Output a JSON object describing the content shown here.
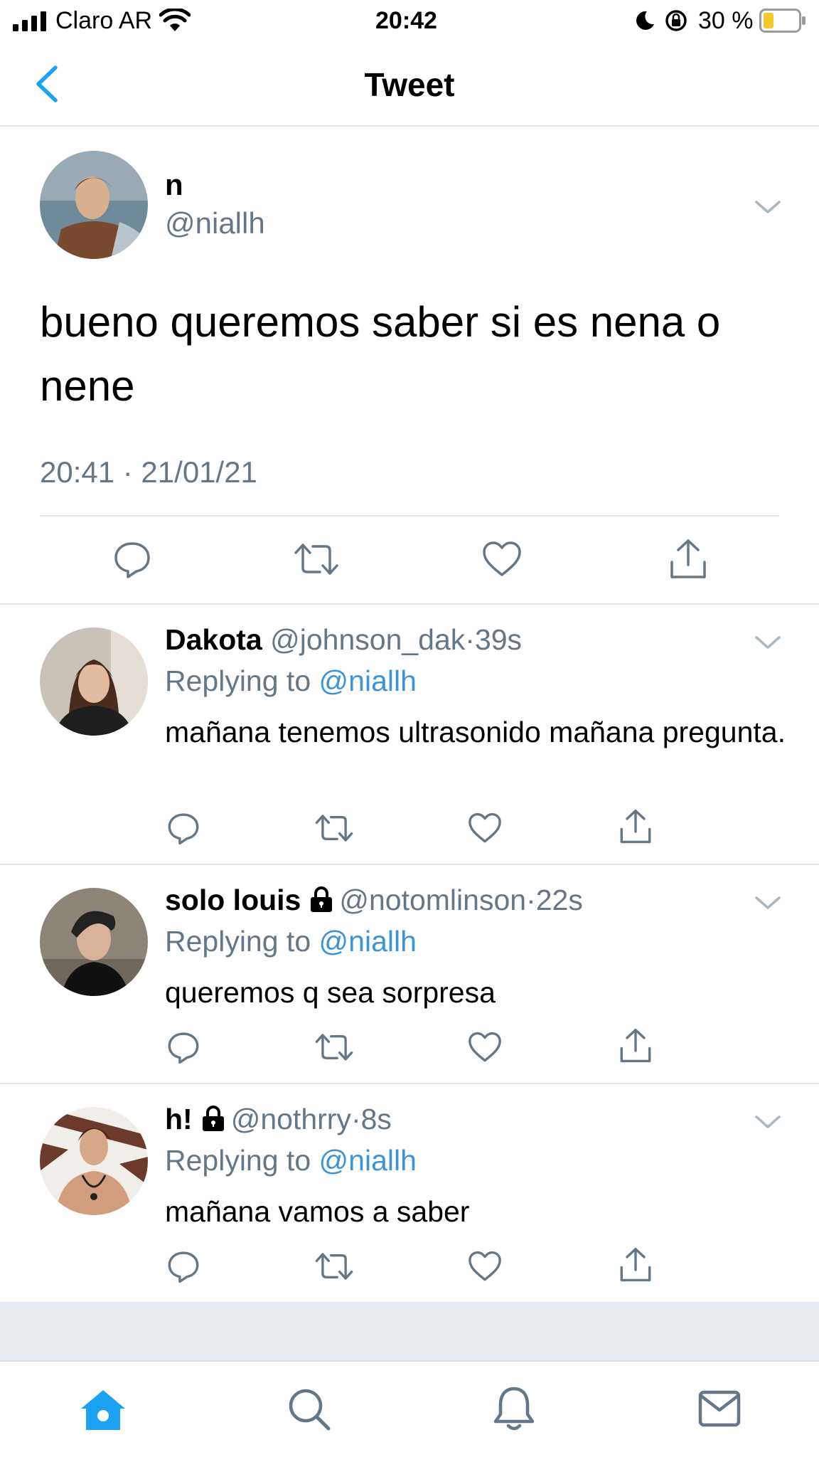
{
  "status_bar": {
    "carrier": "Claro AR",
    "time": "20:42",
    "battery_percent": "30 %",
    "battery_level": 0.3,
    "icons": [
      "signal-bars-icon",
      "wifi-icon",
      "moon-icon",
      "rotation-lock-icon",
      "battery-icon"
    ]
  },
  "nav": {
    "title": "Tweet",
    "back_icon": "chevron-left-icon"
  },
  "tweet": {
    "name": "n",
    "handle": "@niallh",
    "text": "bueno queremos saber si es nena o nene",
    "timestamp": "20:41 · 21/01/21"
  },
  "replies": [
    {
      "name": "Dakota",
      "handle": "@johnson_dak",
      "time": "39s",
      "locked": false,
      "replying_label": "Replying to",
      "replying_to": "@niallh",
      "text": "mañana tenemos ultrasonido mañana pregunta."
    },
    {
      "name": "solo louis",
      "handle": "@notomlinson",
      "time": "22s",
      "locked": true,
      "replying_label": "Replying to",
      "replying_to": "@niallh",
      "text": "queremos q sea sorpresa"
    },
    {
      "name": "h!",
      "handle": "@nothrry",
      "time": "8s",
      "locked": true,
      "replying_label": "Replying to",
      "replying_to": "@niallh",
      "text": "mañana vamos a saber"
    }
  ],
  "separator": "·",
  "action_icons": [
    "reply-icon",
    "retweet-icon",
    "like-icon",
    "share-icon"
  ],
  "tab_bar": [
    "home-icon",
    "search-icon",
    "notifications-icon",
    "messages-icon"
  ],
  "colors": {
    "accent": "#1da1f2",
    "link": "#3b94d9",
    "secondary_text": "#657786",
    "divider": "#e1e6ea"
  }
}
